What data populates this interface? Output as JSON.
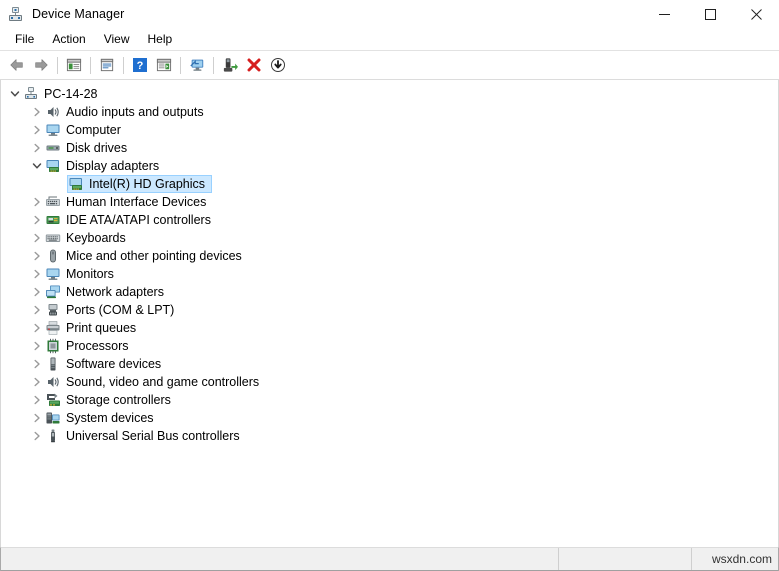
{
  "window": {
    "title": "Device Manager",
    "app_icon": "device-manager-icon",
    "controls": {
      "minimize": "minimize-button",
      "maximize": "maximize-button",
      "close": "close-button"
    }
  },
  "menubar": {
    "items": [
      {
        "label": "File"
      },
      {
        "label": "Action"
      },
      {
        "label": "View"
      },
      {
        "label": "Help"
      }
    ]
  },
  "toolbar": {
    "buttons": [
      {
        "name": "back-button",
        "icon": "back-arrow-icon",
        "tooltip": "Back"
      },
      {
        "name": "forward-button",
        "icon": "forward-arrow-icon",
        "tooltip": "Forward"
      },
      {
        "name": "separator-1",
        "icon": "separator"
      },
      {
        "name": "show-hide-console-tree-button",
        "icon": "console-tree-icon",
        "tooltip": "Show/Hide Console Tree"
      },
      {
        "name": "separator-2",
        "icon": "separator"
      },
      {
        "name": "properties-button",
        "icon": "properties-icon",
        "tooltip": "Properties"
      },
      {
        "name": "separator-3",
        "icon": "separator"
      },
      {
        "name": "help-button",
        "icon": "help-question-icon",
        "tooltip": "Help"
      },
      {
        "name": "show-hide-action-pane-button",
        "icon": "action-pane-icon",
        "tooltip": "Show/Hide Action Pane"
      },
      {
        "name": "separator-4",
        "icon": "separator"
      },
      {
        "name": "scan-for-hardware-changes-button",
        "icon": "monitor-scan-icon",
        "tooltip": "Scan for hardware changes"
      },
      {
        "name": "separator-5",
        "icon": "separator"
      },
      {
        "name": "update-driver-button",
        "icon": "update-driver-icon",
        "tooltip": "Update driver"
      },
      {
        "name": "uninstall-device-button",
        "icon": "red-x-icon",
        "tooltip": "Uninstall device"
      },
      {
        "name": "disable-device-button",
        "icon": "down-arrow-circle-icon",
        "tooltip": "Disable device"
      }
    ]
  },
  "tree": {
    "nodes": [
      {
        "label": "PC-14-28",
        "level": 0,
        "state": "expanded",
        "icon": "computer-root-icon",
        "selected": false
      },
      {
        "label": "Audio inputs and outputs",
        "level": 1,
        "state": "collapsed",
        "icon": "speaker-icon",
        "selected": false
      },
      {
        "label": "Computer",
        "level": 1,
        "state": "collapsed",
        "icon": "monitor-icon",
        "selected": false
      },
      {
        "label": "Disk drives",
        "level": 1,
        "state": "collapsed",
        "icon": "disk-drive-icon",
        "selected": false
      },
      {
        "label": "Display adapters",
        "level": 1,
        "state": "expanded",
        "icon": "display-adapter-icon",
        "selected": false
      },
      {
        "label": "Intel(R) HD Graphics",
        "level": 2,
        "state": "leaf",
        "icon": "display-adapter-icon",
        "selected": true
      },
      {
        "label": "Human Interface Devices",
        "level": 1,
        "state": "collapsed",
        "icon": "hid-icon",
        "selected": false
      },
      {
        "label": "IDE ATA/ATAPI controllers",
        "level": 1,
        "state": "collapsed",
        "icon": "ide-controller-icon",
        "selected": false
      },
      {
        "label": "Keyboards",
        "level": 1,
        "state": "collapsed",
        "icon": "keyboard-icon",
        "selected": false
      },
      {
        "label": "Mice and other pointing devices",
        "level": 1,
        "state": "collapsed",
        "icon": "mouse-icon",
        "selected": false
      },
      {
        "label": "Monitors",
        "level": 1,
        "state": "collapsed",
        "icon": "monitor-icon",
        "selected": false
      },
      {
        "label": "Network adapters",
        "level": 1,
        "state": "collapsed",
        "icon": "network-adapter-icon",
        "selected": false
      },
      {
        "label": "Ports (COM & LPT)",
        "level": 1,
        "state": "collapsed",
        "icon": "port-icon",
        "selected": false
      },
      {
        "label": "Print queues",
        "level": 1,
        "state": "collapsed",
        "icon": "printer-icon",
        "selected": false
      },
      {
        "label": "Processors",
        "level": 1,
        "state": "collapsed",
        "icon": "processor-icon",
        "selected": false
      },
      {
        "label": "Software devices",
        "level": 1,
        "state": "collapsed",
        "icon": "software-device-icon",
        "selected": false
      },
      {
        "label": "Sound, video and game controllers",
        "level": 1,
        "state": "collapsed",
        "icon": "speaker-icon",
        "selected": false
      },
      {
        "label": "Storage controllers",
        "level": 1,
        "state": "collapsed",
        "icon": "storage-controller-icon",
        "selected": false
      },
      {
        "label": "System devices",
        "level": 1,
        "state": "collapsed",
        "icon": "system-device-icon",
        "selected": false
      },
      {
        "label": "Universal Serial Bus controllers",
        "level": 1,
        "state": "collapsed",
        "icon": "usb-icon",
        "selected": false
      }
    ]
  },
  "statusbar": {
    "pane1": "",
    "pane2": "",
    "pane3": "wsxdn.com"
  },
  "colors": {
    "selection_fill": "#cce8ff",
    "selection_border": "#99d1ff",
    "chevron": "#6d6d6d",
    "window_bg": "#ffffff",
    "statusbar_bg": "#f0f0f0",
    "accent_red": "#d61f1f",
    "accent_blue": "#1f6fd0",
    "accent_green": "#3f9b3f"
  }
}
